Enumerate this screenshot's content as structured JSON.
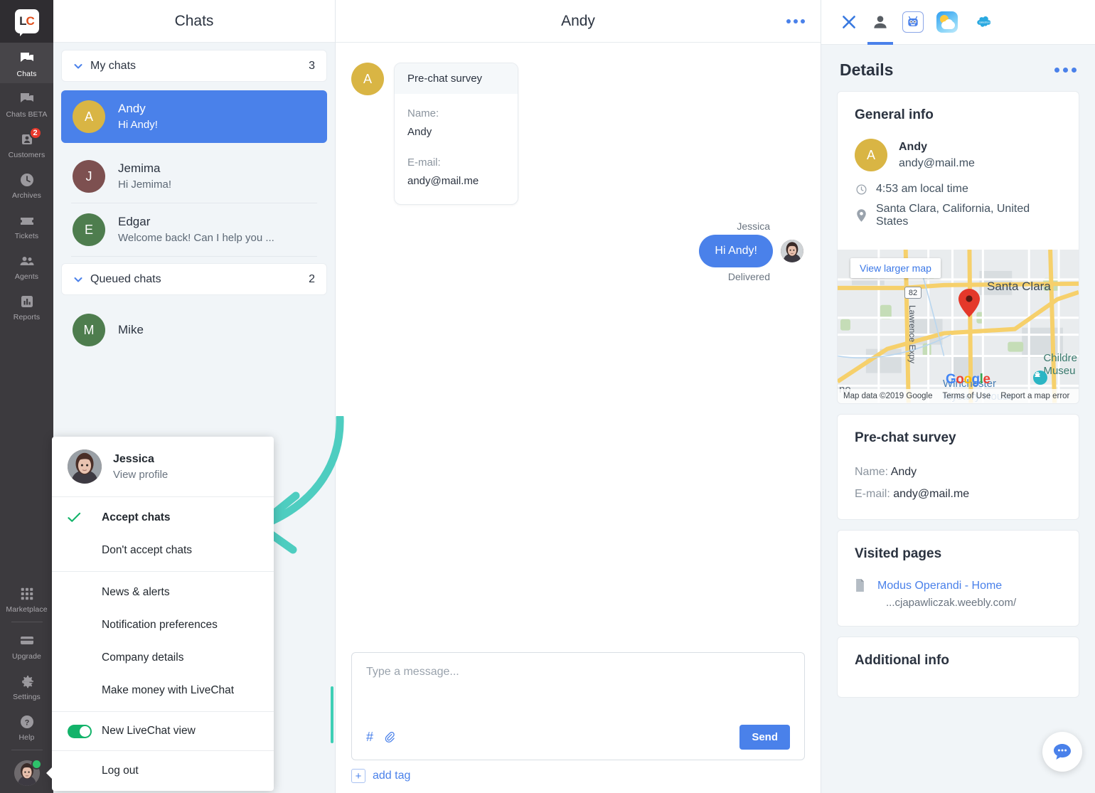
{
  "brand": {
    "logo_text_l": "L",
    "logo_text_c": "C",
    "accent": "#4a81ea",
    "arrow_color": "#4ecdc0",
    "online_color": "#2ec26a"
  },
  "rail": {
    "items": [
      {
        "label": "Chats",
        "icon": "chats-icon",
        "active": true
      },
      {
        "label": "Chats BETA",
        "icon": "chats-beta-icon",
        "active": false
      },
      {
        "label": "Customers",
        "icon": "customers-icon",
        "active": false,
        "badge": "2"
      },
      {
        "label": "Archives",
        "icon": "clock-icon",
        "active": false
      },
      {
        "label": "Tickets",
        "icon": "ticket-icon",
        "active": false
      },
      {
        "label": "Agents",
        "icon": "agents-icon",
        "active": false
      },
      {
        "label": "Reports",
        "icon": "reports-icon",
        "active": false
      }
    ],
    "bottom_items": [
      {
        "label": "Marketplace",
        "icon": "grid-icon"
      },
      {
        "label": "Upgrade",
        "icon": "card-icon"
      },
      {
        "label": "Settings",
        "icon": "gear-icon"
      },
      {
        "label": "Help",
        "icon": "question-icon"
      }
    ]
  },
  "chatlist": {
    "title": "Chats",
    "groups": [
      {
        "label": "My chats",
        "count": "3"
      },
      {
        "label": "Queued chats",
        "count": "2"
      }
    ],
    "my_chats": [
      {
        "name": "Andy",
        "preview": "Hi Andy!",
        "initial": "A",
        "color": "#d9b544",
        "selected": true
      },
      {
        "name": "Jemima",
        "preview": "Hi Jemima!",
        "initial": "J",
        "color": "#7d5050",
        "selected": false
      },
      {
        "name": "Edgar",
        "preview": "Welcome back! Can I help you ...",
        "initial": "E",
        "color": "#4e7d4e",
        "selected": false
      }
    ],
    "queued_chats": [
      {
        "name": "Mike",
        "preview": "",
        "initial": "M",
        "color": "#4e7d4e",
        "selected": false
      }
    ]
  },
  "profile_menu": {
    "name": "Jessica",
    "view_profile": "View profile",
    "accept": "Accept chats",
    "dont_accept": "Don't accept chats",
    "links": [
      "News & alerts",
      "Notification preferences",
      "Company details",
      "Make money with LiveChat"
    ],
    "toggle_label": "New LiveChat view",
    "logout": "Log out"
  },
  "conversation": {
    "title": "Andy",
    "customer_initial": "A",
    "customer_avatar_color": "#d9b544",
    "survey": {
      "header": "Pre-chat survey",
      "name_label": "Name:",
      "name_value": "Andy",
      "email_label": "E-mail:",
      "email_value": "andy@mail.me"
    },
    "outgoing": {
      "author": "Jessica",
      "text": "Hi Andy!",
      "status": "Delivered"
    },
    "composer": {
      "placeholder": "Type a message...",
      "hash_icon": "#",
      "attach_icon": "paperclip-icon",
      "send_label": "Send"
    },
    "add_tag_label": "add tag",
    "add_tag_plus": "+"
  },
  "details": {
    "tabs": [
      {
        "name": "close-icon",
        "label": ""
      },
      {
        "name": "person-icon",
        "label": "",
        "active": true
      },
      {
        "name": "bot-icon",
        "label": ""
      },
      {
        "name": "weather-app-icon",
        "label": ""
      },
      {
        "name": "salesforce-icon",
        "label": "salesforce"
      }
    ],
    "title": "Details",
    "general_info": {
      "title": "General info",
      "name": "Andy",
      "email": "andy@mail.me",
      "initial": "A",
      "avatar_color": "#d9b544",
      "local_time": "4:53 am local time",
      "location": "Santa Clara, California, United States"
    },
    "map": {
      "view_larger": "View larger map",
      "city_label": "Santa Clara",
      "route_shield": "82",
      "expressway": "Lawrence Expy",
      "children_museum": "Childre\nMuseu",
      "winchester": "Winchester\nMystery House",
      "partial_left": "no",
      "google_word": [
        "G",
        "o",
        "o",
        "g",
        "l",
        "e"
      ],
      "attribution": "Map data ©2019 Google",
      "terms": "Terms of Use",
      "report": "Report a map error"
    },
    "prechat": {
      "title": "Pre-chat survey",
      "name_label": "Name:",
      "name_value": "Andy",
      "email_label": "E-mail:",
      "email_value": "andy@mail.me"
    },
    "visited_pages": {
      "title": "Visited pages",
      "link_text": "Modus Operandi - Home",
      "url_text": "...cjapawliczak.weebly.com/"
    },
    "additional_info": {
      "title": "Additional info"
    }
  }
}
